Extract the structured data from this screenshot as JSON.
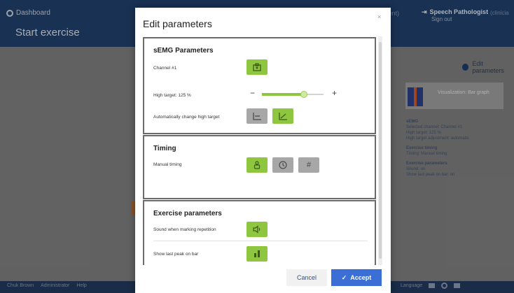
{
  "app": {
    "dashboard_label": "Dashboard",
    "page_title": "Start exercise",
    "patient_label": "patient)",
    "role_label": "Speech Pathologist",
    "role_extra": "(clinicia",
    "signout_label": "Sign out",
    "header_color": "#213f6b",
    "footer_color": "#22395c"
  },
  "background": {
    "edit_parameters": "Edit parameters",
    "visualization_label": "Visualization: Bar graph",
    "info": {
      "semg_heading": "sEMG",
      "semg_lines": [
        "Selected channel: Channel #1",
        "High target: 125 %",
        "High target adjustment: automatic"
      ],
      "timing_heading": "Exercise timing",
      "timing_lines": [
        "Timing: Manual timing"
      ],
      "params_heading": "Exercise parameters",
      "params_lines": [
        "Sound: on",
        "Show last peak on bar: on"
      ]
    }
  },
  "footer": {
    "left_items": [
      "Chuk Brown",
      "Administrator",
      "Help"
    ],
    "right_text": "Language"
  },
  "modal": {
    "title": "Edit parameters",
    "close": "×",
    "semg": {
      "title": "sEMG Parameters",
      "channel_label": "Channel #1",
      "high_target_label": "High target: 125 %",
      "slider_value_fraction": 0.68,
      "slider_minus": "−",
      "slider_plus": "+",
      "auto_label": "Automatically change high target"
    },
    "timing": {
      "title": "Timing",
      "manual_label": "Manual timing"
    },
    "exercise": {
      "title": "Exercise parameters",
      "sound_label": "Sound when marking repetition",
      "peak_label": "Show last peak on bar"
    },
    "cancel_label": "Cancel",
    "accept_label": "Accept",
    "accept_icon": "✓"
  },
  "colors": {
    "active_button": "#8ec63f",
    "inactive_button": "#a7a7a7",
    "accept_button": "#3b6fd6",
    "section_border": "#6b6b6b"
  },
  "icons": {
    "channel": "channel-icon",
    "auto_off": "manual-target-icon",
    "auto_on": "auto-target-icon",
    "manual_timing": "hand-timing-icon",
    "timer": "clock-icon",
    "count": "hash-icon",
    "sound": "speaker-icon",
    "peak": "bar-peak-icon"
  }
}
